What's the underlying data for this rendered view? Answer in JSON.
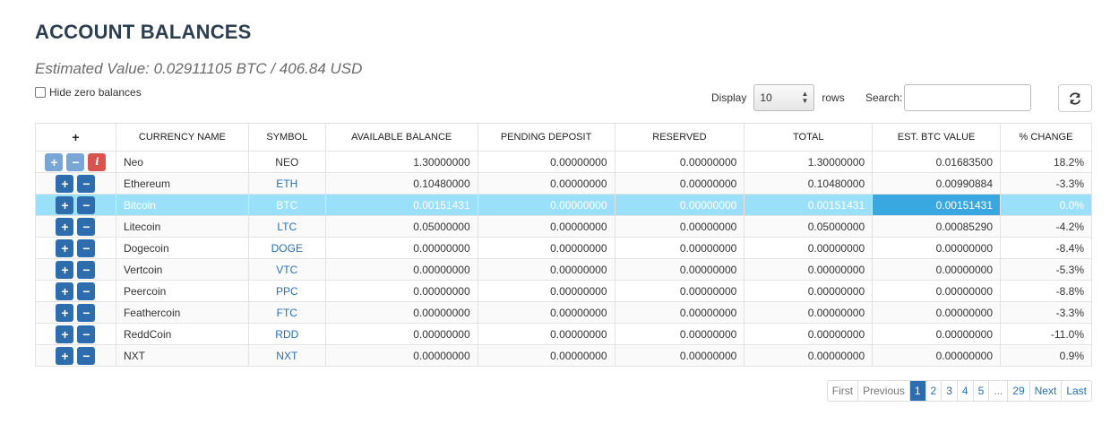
{
  "header": {
    "title": "ACCOUNT BALANCES",
    "estimated_value": "Estimated Value: 0.02911105 BTC / 406.84 USD",
    "hide_zero_label": "Hide zero balances"
  },
  "controls": {
    "display_label": "Display",
    "display_value": "10",
    "rows_label": "rows",
    "search_label": "Search:",
    "search_value": ""
  },
  "table": {
    "columns": [
      "+",
      "CURRENCY NAME",
      "SYMBOL",
      "AVAILABLE BALANCE",
      "PENDING DEPOSIT",
      "RESERVED",
      "TOTAL",
      "EST. BTC VALUE",
      "% CHANGE"
    ],
    "rows": [
      {
        "name": "Neo",
        "symbol": "NEO",
        "available": "1.30000000",
        "pending": "0.00000000",
        "reserved": "0.00000000",
        "total": "1.30000000",
        "btc_value": "0.01683500",
        "change": "18.2%"
      },
      {
        "name": "Ethereum",
        "symbol": "ETH",
        "available": "0.10480000",
        "pending": "0.00000000",
        "reserved": "0.00000000",
        "total": "0.10480000",
        "btc_value": "0.00990884",
        "change": "-3.3%"
      },
      {
        "name": "Bitcoin",
        "symbol": "BTC",
        "available": "0.00151431",
        "pending": "0.00000000",
        "reserved": "0.00000000",
        "total": "0.00151431",
        "btc_value": "0.00151431",
        "change": "0.0%"
      },
      {
        "name": "Litecoin",
        "symbol": "LTC",
        "available": "0.05000000",
        "pending": "0.00000000",
        "reserved": "0.00000000",
        "total": "0.05000000",
        "btc_value": "0.00085290",
        "change": "-4.2%"
      },
      {
        "name": "Dogecoin",
        "symbol": "DOGE",
        "available": "0.00000000",
        "pending": "0.00000000",
        "reserved": "0.00000000",
        "total": "0.00000000",
        "btc_value": "0.00000000",
        "change": "-8.4%"
      },
      {
        "name": "Vertcoin",
        "symbol": "VTC",
        "available": "0.00000000",
        "pending": "0.00000000",
        "reserved": "0.00000000",
        "total": "0.00000000",
        "btc_value": "0.00000000",
        "change": "-5.3%"
      },
      {
        "name": "Peercoin",
        "symbol": "PPC",
        "available": "0.00000000",
        "pending": "0.00000000",
        "reserved": "0.00000000",
        "total": "0.00000000",
        "btc_value": "0.00000000",
        "change": "-8.8%"
      },
      {
        "name": "Feathercoin",
        "symbol": "FTC",
        "available": "0.00000000",
        "pending": "0.00000000",
        "reserved": "0.00000000",
        "total": "0.00000000",
        "btc_value": "0.00000000",
        "change": "-3.3%"
      },
      {
        "name": "ReddCoin",
        "symbol": "RDD",
        "available": "0.00000000",
        "pending": "0.00000000",
        "reserved": "0.00000000",
        "total": "0.00000000",
        "btc_value": "0.00000000",
        "change": "-11.0%"
      },
      {
        "name": "NXT",
        "symbol": "NXT",
        "available": "0.00000000",
        "pending": "0.00000000",
        "reserved": "0.00000000",
        "total": "0.00000000",
        "btc_value": "0.00000000",
        "change": "0.9%"
      }
    ],
    "buttons": {
      "plus": "+",
      "minus": "−",
      "info": "i"
    }
  },
  "pagination": {
    "first": "First",
    "previous": "Previous",
    "pages": [
      "1",
      "2",
      "3",
      "4",
      "5",
      "...",
      "29"
    ],
    "active_page": "1",
    "next": "Next",
    "last": "Last"
  },
  "colors": {
    "accent": "#2e6dad",
    "selected_row": "#9be0fb",
    "selected_cell": "#3aa8e0",
    "info_button": "#d9534f"
  }
}
